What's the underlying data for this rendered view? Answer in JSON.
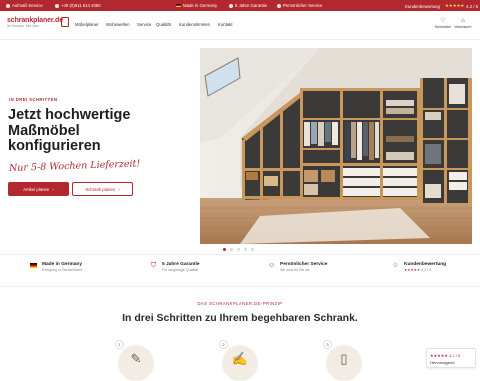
{
  "topbar": {
    "items": [
      {
        "label": "Aufmaß-Service",
        "icon": "ruler-icon"
      },
      {
        "label": "+49 (0)911 514 4080",
        "icon": "phone-icon"
      },
      {
        "label": "Made in Germany",
        "icon": "german-flag-icon"
      },
      {
        "label": "5 Jahre Garantie",
        "icon": "shield-icon"
      },
      {
        "label": "Persönlicher Service",
        "icon": "person-icon"
      }
    ],
    "rating_label": "Kundenbewertung",
    "rating_stars": "★★★★★",
    "rating_value": "4.2 / 5"
  },
  "header": {
    "logo_text": "schrankplaner.de",
    "logo_tagline": "Ihr Schrank. Ihre Idee.",
    "nav": [
      "Möbelplaner",
      "Wohnwelten",
      "Service",
      "Qualität",
      "Kundenstimmen",
      "Kontakt"
    ],
    "wishlist_label": "Merkzettel",
    "cart_label": "Warenkorb"
  },
  "hero": {
    "tag": "IN DREI SCHRITTEN",
    "title_line1": "Jetzt hochwertige",
    "title_line2": "Maßmöbel",
    "title_line3": "konfigurieren",
    "script": "Nur 5-8 Wochen Lieferzeit!",
    "btn_primary": "Artikel planen",
    "btn_secondary": "Schrank planen",
    "slides_total": 5,
    "slide_active": 1
  },
  "features": [
    {
      "title": "Made in Germany",
      "subtitle": "Fertigung in Deutschland",
      "icon": "german-flag-icon"
    },
    {
      "title": "5 Jahre Garantie",
      "subtitle": "Für langlebige Qualität",
      "icon": "check-shield-icon"
    },
    {
      "title": "Persönlicher Service",
      "subtitle": "Wir sind für Sie da",
      "icon": "person-icon"
    },
    {
      "title": "Kundenbewertung",
      "stars": "★★★★★",
      "subtitle": "4.2 / 5",
      "icon": "star-icon"
    }
  ],
  "section": {
    "tag": "DAS SCHRANKPLANER.DE-PRINZIP",
    "title": "In drei Schritten zu Ihrem begehbaren Schrank.",
    "steps": [
      {
        "num": "1",
        "icon": "ruler-icon"
      },
      {
        "num": "2",
        "icon": "notepad-icon"
      },
      {
        "num": "3",
        "icon": "door-icon"
      }
    ]
  },
  "badge": {
    "stars": "★★★★★ 4.2 / 5",
    "label": "Hervorragend"
  },
  "colors": {
    "brand": "#b3272f",
    "wood": "#c9975a"
  }
}
